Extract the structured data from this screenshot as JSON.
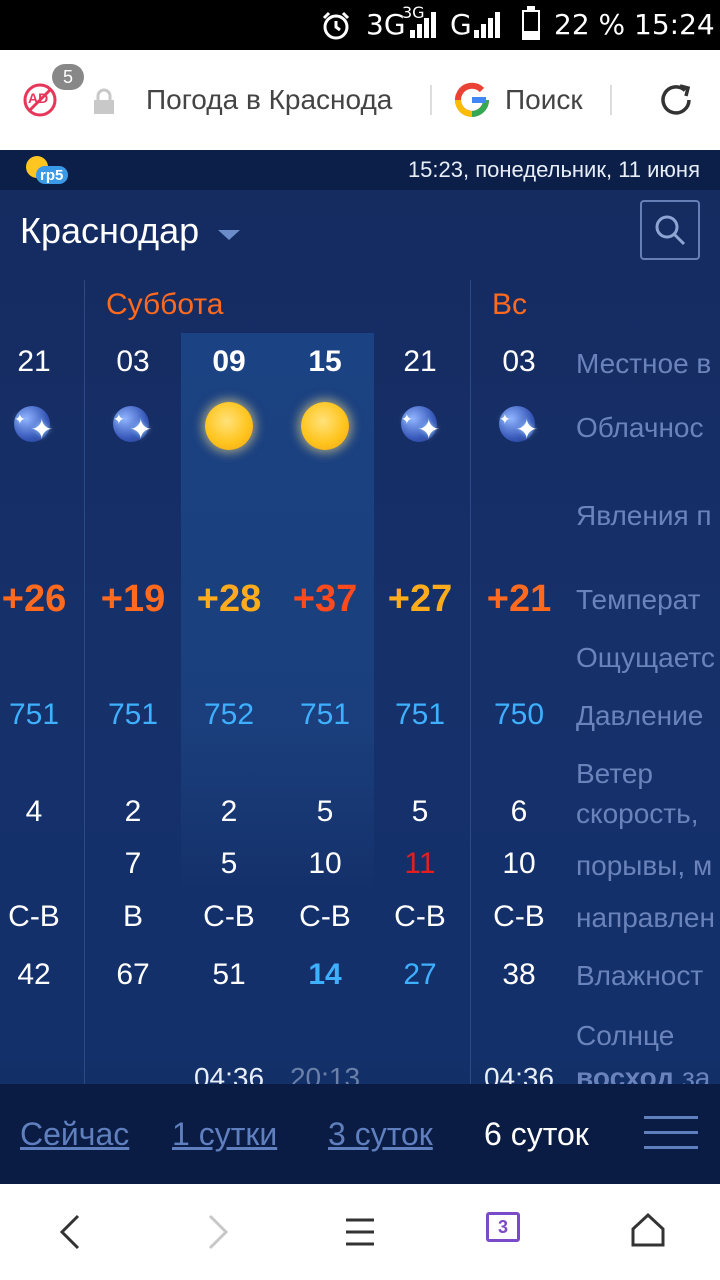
{
  "status_bar": {
    "network1": "3G",
    "network1_sup": "3G",
    "network2": "G",
    "battery": "22 %",
    "time": "15:24",
    "icons": [
      "alarm-icon",
      "signal-icon",
      "battery-icon"
    ]
  },
  "browser": {
    "ad_count": "5",
    "ad_icon_text": "AD",
    "url_title": "Погода в Краснода",
    "search_label": "Поиск",
    "icons": [
      "adblock-icon",
      "lock-icon",
      "google-icon",
      "reload-icon"
    ]
  },
  "header": {
    "logo_text": "rp5",
    "datetime": "15:23, понедельник, 11 июня",
    "city": "Краснодар"
  },
  "forecast": {
    "days": [
      "Суббота",
      "Вс"
    ],
    "columns": [
      {
        "time": "21",
        "icon": "night-clear-icon",
        "temp": "+26",
        "temp_color": "#ff6a1e",
        "pressure": "751",
        "wind_speed": "4",
        "gust": "",
        "direction": "С-В",
        "humidity": "42",
        "sun1": "",
        "sun2": ""
      },
      {
        "time": "03",
        "icon": "night-clear-icon",
        "temp": "+19",
        "temp_color": "#ff6a1e",
        "pressure": "751",
        "wind_speed": "2",
        "gust": "7",
        "direction": "В",
        "humidity": "67",
        "sun1": "",
        "sun2": ""
      },
      {
        "time": "09",
        "icon": "sun-icon",
        "temp": "+28",
        "temp_color": "#ffab1e",
        "pressure": "752",
        "wind_speed": "2",
        "gust": "5",
        "direction": "С-В",
        "humidity": "51",
        "sun1": "04:36",
        "sun2": ""
      },
      {
        "time": "15",
        "icon": "sun-icon",
        "temp": "+37",
        "temp_color": "#ff4a1e",
        "pressure": "751",
        "wind_speed": "5",
        "gust": "10",
        "direction": "С-В",
        "humidity": "14",
        "sun1": "20:13",
        "sun2": ""
      },
      {
        "time": "21",
        "icon": "night-clear-icon",
        "temp": "+27",
        "temp_color": "#ffab1e",
        "pressure": "751",
        "wind_speed": "5",
        "gust": "11",
        "direction": "С-В",
        "humidity": "27",
        "sun1": "",
        "sun2": ""
      },
      {
        "time": "03",
        "icon": "night-clear-icon",
        "temp": "+21",
        "temp_color": "#ff6a1e",
        "pressure": "750",
        "wind_speed": "6",
        "gust": "10",
        "direction": "С-В",
        "humidity": "38",
        "sun1": "04:36",
        "sun2": ""
      }
    ],
    "colors": {
      "gust_alert": "#e02020",
      "humidity_low": "#3eb0ff"
    },
    "param_labels": {
      "local_time": "Местное в",
      "clouds": "Облачнос",
      "phenomena": "Явления п",
      "temperature": "Температ",
      "feels_like": "Ощущаетс",
      "pressure": "Давление",
      "wind": "Ветер",
      "wind_speed": "скорость,",
      "gusts": "порывы, м",
      "direction": "направлен",
      "humidity": "Влажност",
      "sun": "Солнце",
      "sunrise": "восход",
      "sunrise_suffix": " за"
    }
  },
  "tabs": {
    "now": "Сейчас",
    "one_day": "1 сутки",
    "three_days": "3 суток",
    "six_days": "6 суток",
    "active": "six_days"
  },
  "navbar": {
    "tab_count": "3",
    "icons": [
      "back-icon",
      "forward-icon",
      "menu-icon",
      "tabs-icon",
      "home-icon"
    ]
  }
}
